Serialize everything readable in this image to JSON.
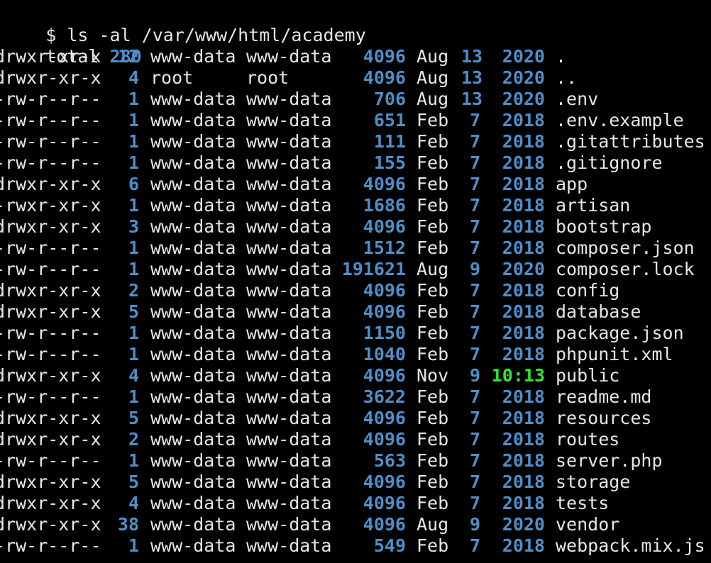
{
  "terminal": {
    "prompt": "$ ls -al /var/www/html/academy",
    "total_label": "total",
    "total_value": "280",
    "entries": [
      {
        "perms": "drwxr-xr-x",
        "links": "12",
        "owner": "www-data",
        "group": "www-data",
        "size": "4096",
        "month": "Aug",
        "day": "13",
        "year": "2020",
        "name": ".",
        "recent": false
      },
      {
        "perms": "drwxr-xr-x",
        "links": "4",
        "owner": "root",
        "group": "root",
        "size": "4096",
        "month": "Aug",
        "day": "13",
        "year": "2020",
        "name": "..",
        "recent": false
      },
      {
        "perms": "-rw-r--r--",
        "links": "1",
        "owner": "www-data",
        "group": "www-data",
        "size": "706",
        "month": "Aug",
        "day": "13",
        "year": "2020",
        "name": ".env",
        "recent": false
      },
      {
        "perms": "-rw-r--r--",
        "links": "1",
        "owner": "www-data",
        "group": "www-data",
        "size": "651",
        "month": "Feb",
        "day": "7",
        "year": "2018",
        "name": ".env.example",
        "recent": false
      },
      {
        "perms": "-rw-r--r--",
        "links": "1",
        "owner": "www-data",
        "group": "www-data",
        "size": "111",
        "month": "Feb",
        "day": "7",
        "year": "2018",
        "name": ".gitattributes",
        "recent": false
      },
      {
        "perms": "-rw-r--r--",
        "links": "1",
        "owner": "www-data",
        "group": "www-data",
        "size": "155",
        "month": "Feb",
        "day": "7",
        "year": "2018",
        "name": ".gitignore",
        "recent": false
      },
      {
        "perms": "drwxr-xr-x",
        "links": "6",
        "owner": "www-data",
        "group": "www-data",
        "size": "4096",
        "month": "Feb",
        "day": "7",
        "year": "2018",
        "name": "app",
        "recent": false
      },
      {
        "perms": "-rwxr-xr-x",
        "links": "1",
        "owner": "www-data",
        "group": "www-data",
        "size": "1686",
        "month": "Feb",
        "day": "7",
        "year": "2018",
        "name": "artisan",
        "recent": false
      },
      {
        "perms": "drwxr-xr-x",
        "links": "3",
        "owner": "www-data",
        "group": "www-data",
        "size": "4096",
        "month": "Feb",
        "day": "7",
        "year": "2018",
        "name": "bootstrap",
        "recent": false
      },
      {
        "perms": "-rw-r--r--",
        "links": "1",
        "owner": "www-data",
        "group": "www-data",
        "size": "1512",
        "month": "Feb",
        "day": "7",
        "year": "2018",
        "name": "composer.json",
        "recent": false
      },
      {
        "perms": "-rw-r--r--",
        "links": "1",
        "owner": "www-data",
        "group": "www-data",
        "size": "191621",
        "month": "Aug",
        "day": "9",
        "year": "2020",
        "name": "composer.lock",
        "recent": false
      },
      {
        "perms": "drwxr-xr-x",
        "links": "2",
        "owner": "www-data",
        "group": "www-data",
        "size": "4096",
        "month": "Feb",
        "day": "7",
        "year": "2018",
        "name": "config",
        "recent": false
      },
      {
        "perms": "drwxr-xr-x",
        "links": "5",
        "owner": "www-data",
        "group": "www-data",
        "size": "4096",
        "month": "Feb",
        "day": "7",
        "year": "2018",
        "name": "database",
        "recent": false
      },
      {
        "perms": "-rw-r--r--",
        "links": "1",
        "owner": "www-data",
        "group": "www-data",
        "size": "1150",
        "month": "Feb",
        "day": "7",
        "year": "2018",
        "name": "package.json",
        "recent": false
      },
      {
        "perms": "-rw-r--r--",
        "links": "1",
        "owner": "www-data",
        "group": "www-data",
        "size": "1040",
        "month": "Feb",
        "day": "7",
        "year": "2018",
        "name": "phpunit.xml",
        "recent": false
      },
      {
        "perms": "drwxr-xr-x",
        "links": "4",
        "owner": "www-data",
        "group": "www-data",
        "size": "4096",
        "month": "Nov",
        "day": "9",
        "year": "10:13",
        "name": "public",
        "recent": true
      },
      {
        "perms": "-rw-r--r--",
        "links": "1",
        "owner": "www-data",
        "group": "www-data",
        "size": "3622",
        "month": "Feb",
        "day": "7",
        "year": "2018",
        "name": "readme.md",
        "recent": false
      },
      {
        "perms": "drwxr-xr-x",
        "links": "5",
        "owner": "www-data",
        "group": "www-data",
        "size": "4096",
        "month": "Feb",
        "day": "7",
        "year": "2018",
        "name": "resources",
        "recent": false
      },
      {
        "perms": "drwxr-xr-x",
        "links": "2",
        "owner": "www-data",
        "group": "www-data",
        "size": "4096",
        "month": "Feb",
        "day": "7",
        "year": "2018",
        "name": "routes",
        "recent": false
      },
      {
        "perms": "-rw-r--r--",
        "links": "1",
        "owner": "www-data",
        "group": "www-data",
        "size": "563",
        "month": "Feb",
        "day": "7",
        "year": "2018",
        "name": "server.php",
        "recent": false
      },
      {
        "perms": "drwxr-xr-x",
        "links": "5",
        "owner": "www-data",
        "group": "www-data",
        "size": "4096",
        "month": "Feb",
        "day": "7",
        "year": "2018",
        "name": "storage",
        "recent": false
      },
      {
        "perms": "drwxr-xr-x",
        "links": "4",
        "owner": "www-data",
        "group": "www-data",
        "size": "4096",
        "month": "Feb",
        "day": "7",
        "year": "2018",
        "name": "tests",
        "recent": false
      },
      {
        "perms": "drwxr-xr-x",
        "links": "38",
        "owner": "www-data",
        "group": "www-data",
        "size": "4096",
        "month": "Aug",
        "day": "9",
        "year": "2020",
        "name": "vendor",
        "recent": false
      },
      {
        "perms": "-rw-r--r--",
        "links": "1",
        "owner": "www-data",
        "group": "www-data",
        "size": "549",
        "month": "Feb",
        "day": "7",
        "year": "2018",
        "name": "webpack.mix.js",
        "recent": false
      }
    ],
    "colors": {
      "background": "#000000",
      "text": "#e6e6e6",
      "number": "#4f8fc8",
      "recent_time": "#2ee62e"
    }
  }
}
